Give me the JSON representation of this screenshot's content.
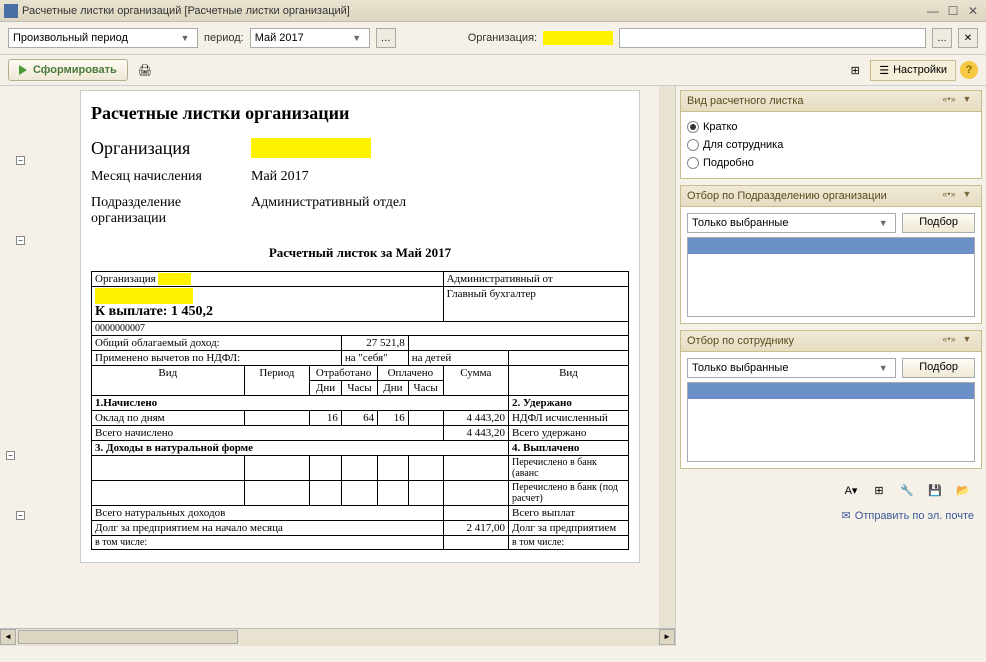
{
  "titlebar": {
    "title": "Расчетные листки организаций [Расчетные листки организаций]"
  },
  "toolbar": {
    "period_type": "Произвольный период",
    "period_label": "период:",
    "period_value": "Май 2017",
    "org_label": "Организация:"
  },
  "toolbar2": {
    "generate_label": "Сформировать",
    "settings_label": "Настройки"
  },
  "doc": {
    "title": "Расчетные листки организации",
    "org_label": "Организация",
    "month_label": "Месяц начисления",
    "month_value": "Май 2017",
    "dept_label": "Подразделение организации",
    "dept_value": "Административный отдел",
    "slip_title": "Расчетный листок за Май 2017",
    "org_row_label": "Организация",
    "dept_right": "Административный от",
    "payout_label": "К выплате: 1 450,2",
    "position_right": "Главный бухгалтер",
    "emp_num": "0000000007",
    "taxable_income_label": "Общий облагаемый доход:",
    "taxable_income_value": "27 521,8",
    "deductions_label": "Применено вычетов по НДФЛ:",
    "deductions_self": "на \"себя\"",
    "deductions_children": "на детей",
    "headers": {
      "type": "Вид",
      "period": "Период",
      "worked": "Отработано",
      "paid": "Оплачено",
      "sum": "Сумма",
      "type2": "Вид",
      "days": "Дни",
      "hours": "Часы"
    },
    "sections": {
      "accrued": "1.Начислено",
      "withheld": "2. Удержано",
      "natural": "3. Доходы в натуральной форме",
      "paid_out": "4. Выплачено"
    },
    "rows": {
      "salary_days": "Оклад по дням",
      "salary_d1": "16",
      "salary_h1": "64",
      "salary_d2": "16",
      "salary_sum": "4 443,20",
      "ndfl": "НДФЛ исчисленный",
      "total_accrued": "Всего начислено",
      "total_accrued_sum": "4 443,20",
      "total_withheld": "Всего удержано",
      "bank_advance": "Перечислено в банк (аванс",
      "bank_payroll": "Перечислено в банк (под расчет)",
      "total_natural": "Всего натуральных доходов",
      "total_payouts": "Всего выплат",
      "debt_start": "Долг за предприятием на начало месяца",
      "debt_start_sum": "2 417,00",
      "debt_end": "Долг за предприятием",
      "including": "в том числе:"
    }
  },
  "panels": {
    "view_type": {
      "title": "Вид расчетного листка",
      "opt1": "Кратко",
      "opt2": "Для сотрудника",
      "opt3": "Подробно"
    },
    "dept_filter": {
      "title": "Отбор по Подразделению организации",
      "dropdown": "Только выбранные",
      "button": "Подбор"
    },
    "emp_filter": {
      "title": "Отбор по сотруднику",
      "dropdown": "Только выбранные",
      "button": "Подбор"
    }
  },
  "bottom": {
    "send_label": "Отправить по эл. почте"
  }
}
